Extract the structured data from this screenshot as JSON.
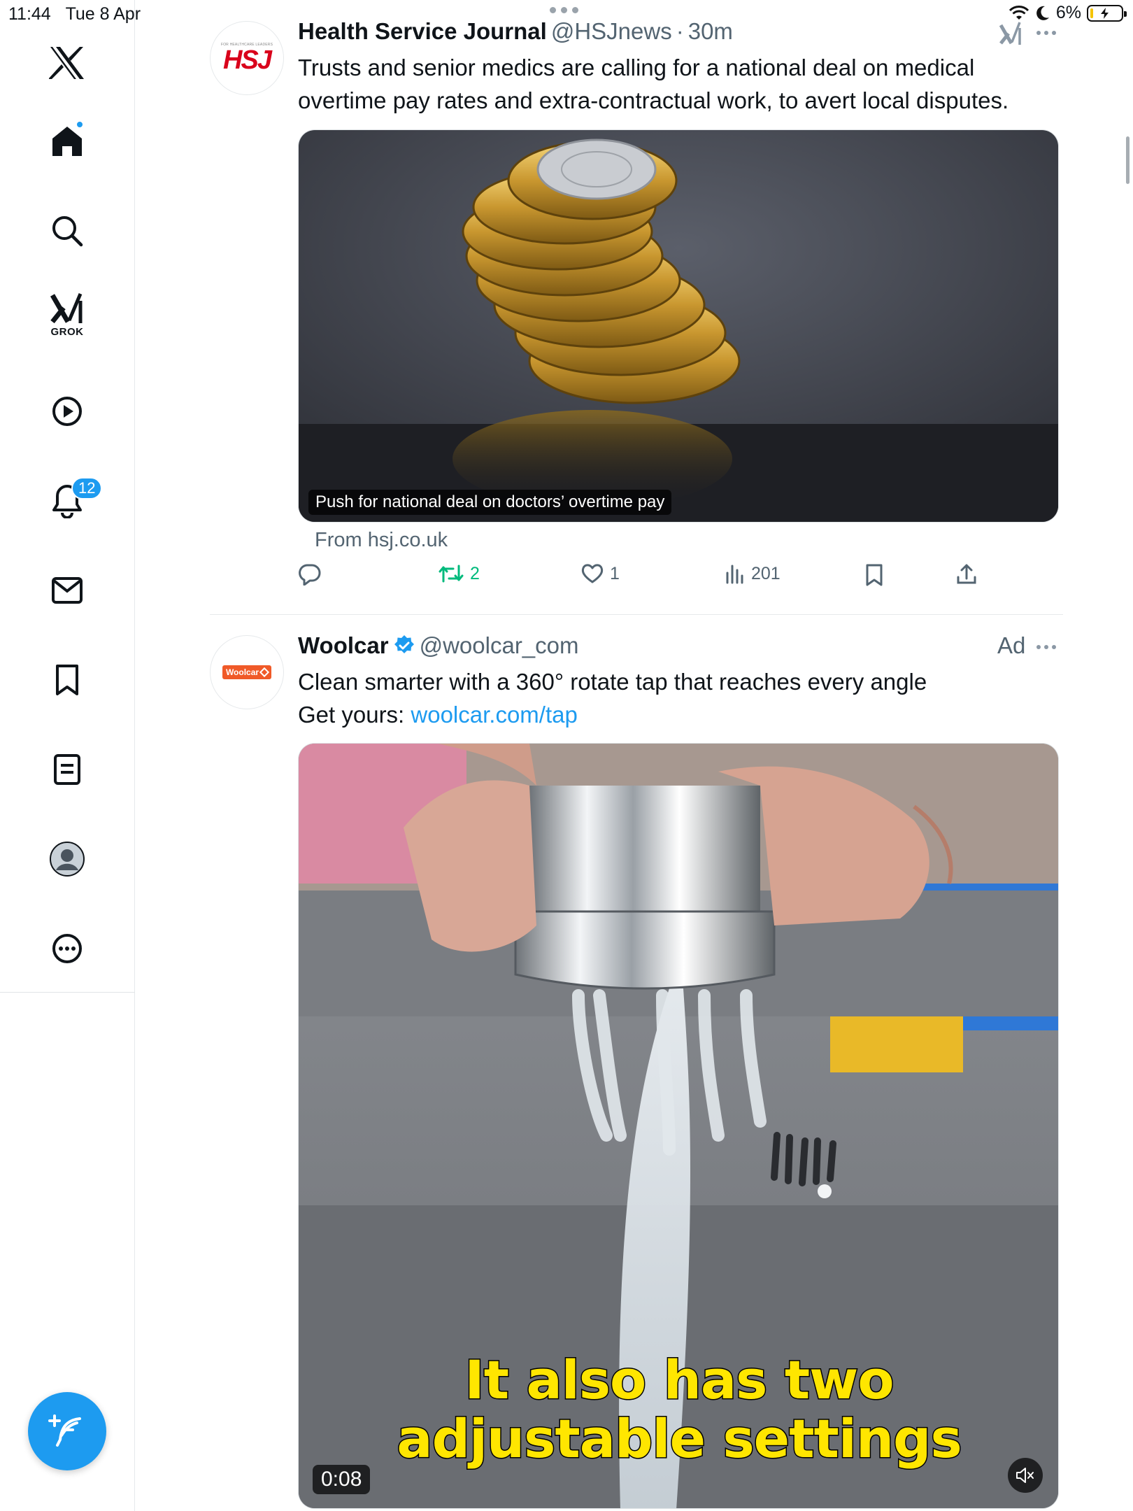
{
  "status_bar": {
    "time": "11:44",
    "date": "Tue 8 Apr",
    "battery": "6%"
  },
  "sidebar": {
    "items": [
      {
        "name": "x-logo-icon"
      },
      {
        "name": "home-icon",
        "active": true
      },
      {
        "name": "search-icon"
      },
      {
        "name": "grok-icon",
        "label": "GROK"
      },
      {
        "name": "video-icon"
      },
      {
        "name": "notifications-icon",
        "badge": "12"
      },
      {
        "name": "messages-icon"
      },
      {
        "name": "bookmarks-icon"
      },
      {
        "name": "lists-icon"
      },
      {
        "name": "profile-icon"
      },
      {
        "name": "more-icon"
      }
    ],
    "compose": "compose-icon"
  },
  "tweets": [
    {
      "display_name": "Health Service Journal",
      "handle": "@HSJnews",
      "separator": "·",
      "time": "30m",
      "avatar_text": "HSJ",
      "avatar_subtext": "FOR HEALTHCARE LEADERS",
      "text": "Trusts and senior medics are calling for a national deal on medical overtime pay rates and extra-contractual work, to avert local disputes.",
      "card_caption": "Push for national deal on doctors’ overtime pay",
      "card_source": "From hsj.co.uk",
      "stats": {
        "replies": "",
        "reposts": "2",
        "likes": "1",
        "views": "201"
      }
    },
    {
      "display_name": "Woolcar",
      "handle": "@woolcar_com",
      "verified": true,
      "ad_label": "Ad",
      "avatar_text": "Woolcar",
      "text_line1": "Clean smarter with a 360° rotate tap that reaches every angle",
      "text_line2_prefix": "Get yours: ",
      "link": "woolcar.com/tap",
      "video": {
        "time": "0:08",
        "subtitle_line1": "It also has two",
        "subtitle_line2": "adjustable settings",
        "muted": true
      }
    }
  ],
  "colors": {
    "accent": "#1d9bf0",
    "repost_green": "#00ba7c",
    "secondary_text": "#536471",
    "hsj_red": "#d9001b",
    "woolcar_orange": "#f05a28"
  }
}
